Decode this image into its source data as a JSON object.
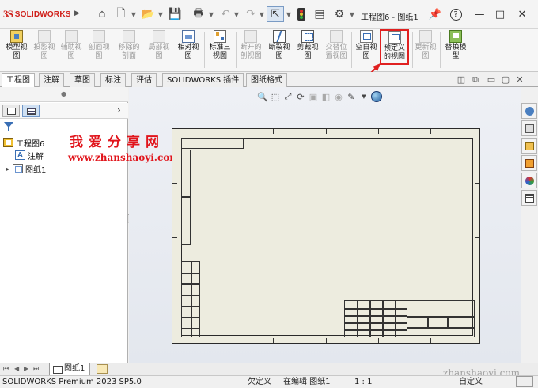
{
  "app": {
    "logo_mark": "3S",
    "logo_text": "SOLIDWORKS",
    "doc_title": "工程图6 - 图纸1"
  },
  "quick_access": [
    {
      "name": "home-icon",
      "glyph": "⌂"
    },
    {
      "name": "new-file-icon",
      "glyph": "🗋"
    },
    {
      "name": "open-file-icon",
      "glyph": "📂"
    },
    {
      "name": "save-icon",
      "glyph": "💾"
    },
    {
      "name": "print-icon",
      "glyph": "🖶"
    },
    {
      "name": "undo-icon",
      "glyph": "↶"
    },
    {
      "name": "redo-icon",
      "glyph": "↷"
    },
    {
      "name": "select-icon",
      "glyph": "⇱"
    },
    {
      "name": "traffic-light-icon",
      "glyph": "🚦"
    },
    {
      "name": "file-properties-icon",
      "glyph": "▤"
    },
    {
      "name": "options-gear-icon",
      "glyph": "⚙"
    }
  ],
  "window_controls": {
    "pin": "📌",
    "help": "?",
    "minimize": "—",
    "maximize": "□",
    "close": "✕"
  },
  "ribbon": [
    {
      "id": "model-view",
      "label": "模型视\n图",
      "icon": "ico-model",
      "enabled": true
    },
    {
      "id": "projected-view",
      "label": "投影视\n图",
      "icon": "ico-gray",
      "enabled": false
    },
    {
      "id": "auxiliary-view",
      "label": "辅助视\n图",
      "icon": "ico-gray",
      "enabled": false
    },
    {
      "id": "section-view",
      "label": "剖面视\n图",
      "icon": "ico-gray",
      "enabled": false
    },
    {
      "id": "removed-section",
      "label": "移除的\n剖面",
      "icon": "ico-gray",
      "enabled": false
    },
    {
      "id": "detail-view",
      "label": "局部视\n图",
      "icon": "ico-gray",
      "enabled": false
    },
    {
      "id": "relative-view",
      "label": "相对视\n图",
      "icon": "ico-blue",
      "enabled": true
    },
    {
      "id": "standard-3-view",
      "label": "标准三\n视图",
      "icon": "ico-std",
      "enabled": true
    },
    {
      "id": "broken-out-section",
      "label": "断开的\n剖视图",
      "icon": "ico-gray",
      "enabled": false
    },
    {
      "id": "break",
      "label": "断裂视\n图",
      "icon": "ico-break",
      "enabled": true
    },
    {
      "id": "crop-view",
      "label": "剪裁视\n图",
      "icon": "ico-crop",
      "enabled": true
    },
    {
      "id": "alternate-position",
      "label": "交替位\n置视图",
      "icon": "ico-gray",
      "enabled": false
    },
    {
      "id": "empty-view",
      "label": "空白视\n图",
      "icon": "ico-sheet",
      "enabled": true
    },
    {
      "id": "predefined-view",
      "label": "预定义\n的视图",
      "icon": "ico-sheet",
      "enabled": true
    },
    {
      "id": "update-view",
      "label": "更新视\n图",
      "icon": "ico-gray",
      "enabled": false
    },
    {
      "id": "replace-model",
      "label": "替换模\n型",
      "icon": "ico-replace",
      "enabled": true
    }
  ],
  "tabs": [
    "工程图",
    "注解",
    "草图",
    "标注",
    "评估",
    "SOLIDWORKS 插件",
    "图纸格式"
  ],
  "tree": {
    "root": "工程图6",
    "items": [
      "注解",
      "图纸1"
    ]
  },
  "watermark": {
    "cn": "我爱分享网",
    "url": "www.zhanshaoyi.com",
    "url_bottom": "zhanshaoyi.com"
  },
  "sheet_tab": "图纸1",
  "status": {
    "product": "SOLIDWORKS Premium 2023 SP5.0",
    "definition": "欠定义",
    "editing": "在编辑 图纸1",
    "scale": "1 : 1",
    "custom": "自定义"
  }
}
